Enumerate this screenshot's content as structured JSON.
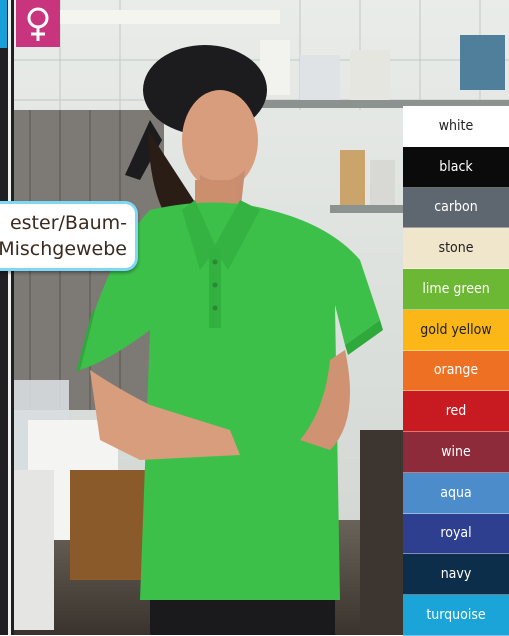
{
  "fabric_label": {
    "line1": "ester/Baum-",
    "line2": "Mischgewebe"
  },
  "badge": {
    "icon": "female-symbol-icon",
    "color": "#c9347f"
  },
  "colors": [
    {
      "name": "white",
      "hex": "#ffffff",
      "text": "#222222"
    },
    {
      "name": "black",
      "hex": "#0b0b0b",
      "text": "#ffffff"
    },
    {
      "name": "carbon",
      "hex": "#5e676f",
      "text": "#ffffff"
    },
    {
      "name": "stone",
      "hex": "#efe6cb",
      "text": "#222222"
    },
    {
      "name": "lime green",
      "hex": "#6cb733",
      "text": "#ffffff"
    },
    {
      "name": "gold yellow",
      "hex": "#fbb617",
      "text": "#222222"
    },
    {
      "name": "orange",
      "hex": "#ee7023",
      "text": "#ffffff"
    },
    {
      "name": "red",
      "hex": "#c81a21",
      "text": "#ffffff"
    },
    {
      "name": "wine",
      "hex": "#8e2b3b",
      "text": "#ffffff"
    },
    {
      "name": "aqua",
      "hex": "#4d8ccb",
      "text": "#ffffff"
    },
    {
      "name": "royal",
      "hex": "#2f3f8f",
      "text": "#ffffff"
    },
    {
      "name": "navy",
      "hex": "#0d2e4b",
      "text": "#ffffff"
    },
    {
      "name": "turquoise",
      "hex": "#1aa4d8",
      "text": "#ffffff"
    }
  ]
}
